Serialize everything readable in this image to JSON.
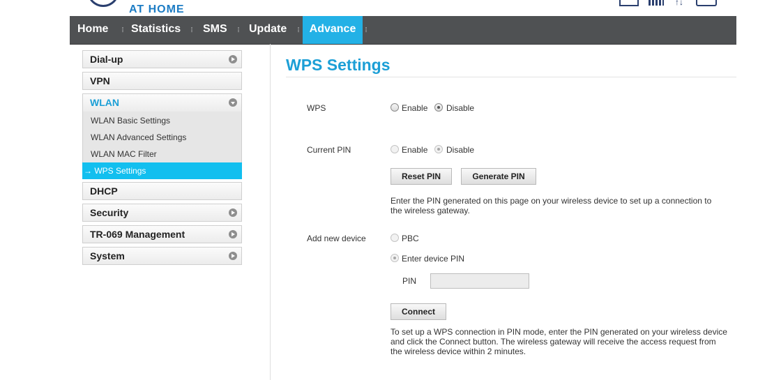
{
  "header": {
    "logo_text": "AT HOME",
    "icons": [
      "mail-icon",
      "signal-icon",
      "updown-arrows-icon",
      "monitor-icon"
    ]
  },
  "nav": {
    "items": [
      {
        "label": "Home"
      },
      {
        "label": "Statistics"
      },
      {
        "label": "SMS"
      },
      {
        "label": "Update"
      },
      {
        "label": "Advance",
        "active": true
      }
    ],
    "bar_color": "#4f5153",
    "active_color": "#23b1e6"
  },
  "sidebar": {
    "items": [
      {
        "label": "Dial-up",
        "icon": "chevron-right-icon"
      },
      {
        "label": "VPN"
      },
      {
        "label": "WLAN",
        "icon": "chevron-down-icon",
        "expanded": true
      },
      {
        "label": "DHCP"
      },
      {
        "label": "Security",
        "icon": "chevron-right-icon"
      },
      {
        "label": "TR-069 Management",
        "icon": "chevron-right-icon"
      },
      {
        "label": "System",
        "icon": "chevron-right-icon"
      }
    ],
    "wlan_subitems": [
      {
        "label": "WLAN Basic Settings"
      },
      {
        "label": "WLAN Advanced Settings"
      },
      {
        "label": "WLAN MAC Filter"
      },
      {
        "label": "→ WPS Settings",
        "active": true
      }
    ]
  },
  "main": {
    "title": "WPS Settings",
    "wps": {
      "label": "WPS",
      "options": [
        "Enable",
        "Disable"
      ],
      "selected": "Disable"
    },
    "current_pin": {
      "label": "Current PIN",
      "options": [
        "Enable",
        "Disable"
      ],
      "selected": "Disable",
      "disabled": true
    },
    "buttons": {
      "reset_pin": "Reset PIN",
      "generate_pin": "Generate PIN",
      "connect": "Connect"
    },
    "pin_help": "Enter the PIN generated on this page on your wireless device to set up a connection to the wireless gateway.",
    "add_device": {
      "label": "Add new device",
      "options": [
        "PBC",
        "Enter device PIN"
      ],
      "selected": "Enter device PIN",
      "disabled": true,
      "pin_label": "PIN",
      "pin_value": ""
    },
    "connect_help": "To set up a WPS connection in PIN mode, enter the PIN generated on your wireless device and click the Connect button. The wireless gateway will receive the access request from the wireless device within 2 minutes."
  }
}
